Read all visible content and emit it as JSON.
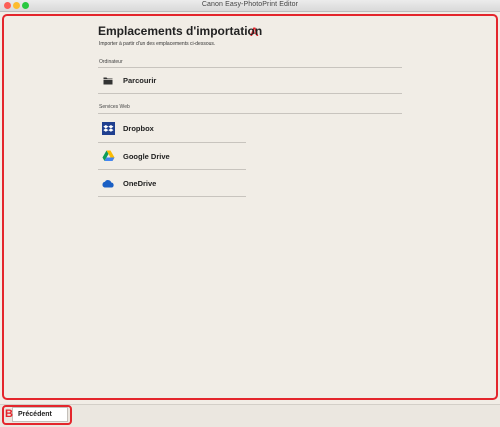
{
  "window": {
    "title": "Canon Easy-PhotoPrint Editor"
  },
  "main": {
    "title": "Emplacements d'importation",
    "subtitle": "Importer à partir d'un des emplacements ci-dessous.",
    "computer_section": {
      "label": "Ordinateur",
      "items": [
        {
          "label": "Parcourir",
          "icon": "folder-icon"
        }
      ]
    },
    "web_section": {
      "label": "Services Web",
      "items": [
        {
          "label": "Dropbox",
          "icon": "dropbox-icon"
        },
        {
          "label": "Google Drive",
          "icon": "google-drive-icon"
        },
        {
          "label": "OneDrive",
          "icon": "onedrive-icon"
        }
      ]
    }
  },
  "footer": {
    "back_label": "Précédent"
  },
  "annotations": {
    "a": "A",
    "b": "B"
  },
  "colors": {
    "annotation_red": "#e4262c",
    "background": "#f1ede6",
    "dropbox_blue": "#1f3f8f",
    "onedrive_blue": "#1a5fc4"
  }
}
